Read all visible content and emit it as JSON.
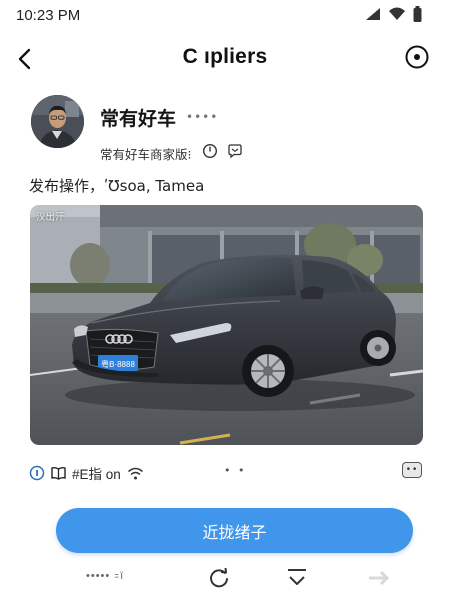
{
  "status_bar": {
    "time": "10:23 PM",
    "icons": [
      "signal-icon",
      "wifi-icon",
      "battery-icon"
    ]
  },
  "header": {
    "title": "C ıpliers",
    "back_icon": "chevron-left-icon",
    "action_icon": "target-icon"
  },
  "profile": {
    "name": "常有好车",
    "name_dots": "••••",
    "subtitle": "常有好车商家版⁝",
    "sub_icons": [
      "clock-icon",
      "chat-bubble-icon"
    ]
  },
  "post": {
    "text": "发布操作，ʹ℧soa, Tamea",
    "photo_caption": "汉出汗"
  },
  "meta": {
    "text": "#E指 on",
    "dots": "• •",
    "more_label": "••",
    "icons": [
      "info-icon",
      "book-icon",
      "wifi-icon"
    ]
  },
  "primary_button": {
    "label": "近拢绪子"
  },
  "bottom_bar": {
    "left_text": "••••• ꞊ï",
    "icons": [
      "refresh-icon",
      "chevron-down-icon",
      "arrow-right-icon"
    ]
  },
  "colors": {
    "accent": "#4096ea",
    "text": "#1b1b1b",
    "car_body": "#3a3d44",
    "plate": "#2f7fd8"
  }
}
